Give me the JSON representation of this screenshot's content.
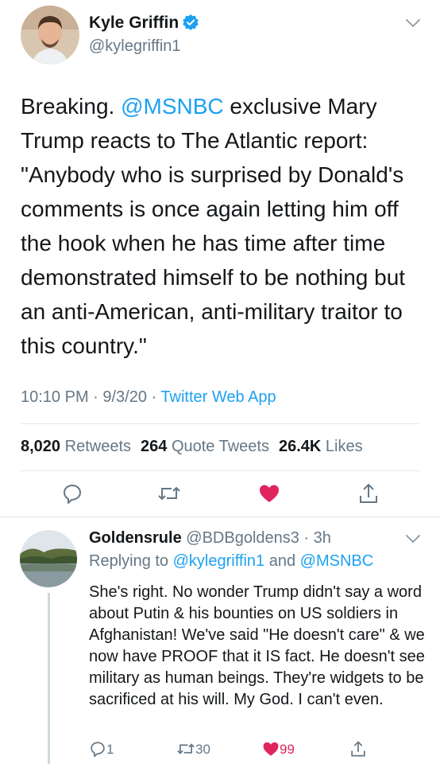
{
  "tweet": {
    "author_name": "Kyle Griffin",
    "author_handle": "@kylegriffin1",
    "text_lead": "Breaking. ",
    "text_mention": "@MSNBC",
    "text_rest": " exclusive Mary Trump reacts to The Atlantic report: \"Anybody who is surprised by Donald's comments is once again letting him off the hook when he has time after time demonstrated himself to be nothing but an anti-American, anti-military traitor to this country.\"",
    "time": "10:10 PM · 9/3/20 · ",
    "source": "Twitter Web App",
    "retweets_count": "8,020",
    "retweets_label": "Retweets",
    "quotes_count": "264",
    "quotes_label": "Quote Tweets",
    "likes_count": "26.4K",
    "likes_label": "Likes"
  },
  "reply": {
    "author_name": "Goldensrule",
    "author_handle": "@BDBgoldens3",
    "time": " · 3h",
    "replying_prefix": "Replying to ",
    "replying_to_1": "@kylegriffin1",
    "replying_and": " and ",
    "replying_to_2": "@MSNBC",
    "text": "She's right. No wonder Trump didn't say a word about Putin & his bounties on US soldiers in Afghanistan! We've said \"He doesn't care\" & we now have PROOF that it IS fact. He doesn't see military as human beings. They're widgets to be sacrificed at his will. My God. I can't even.",
    "reply_count": "1",
    "retweet_count": "30",
    "like_count": "99"
  },
  "colors": {
    "accent": "#1da1f2",
    "like_red": "#e0245e",
    "muted": "#657786"
  }
}
